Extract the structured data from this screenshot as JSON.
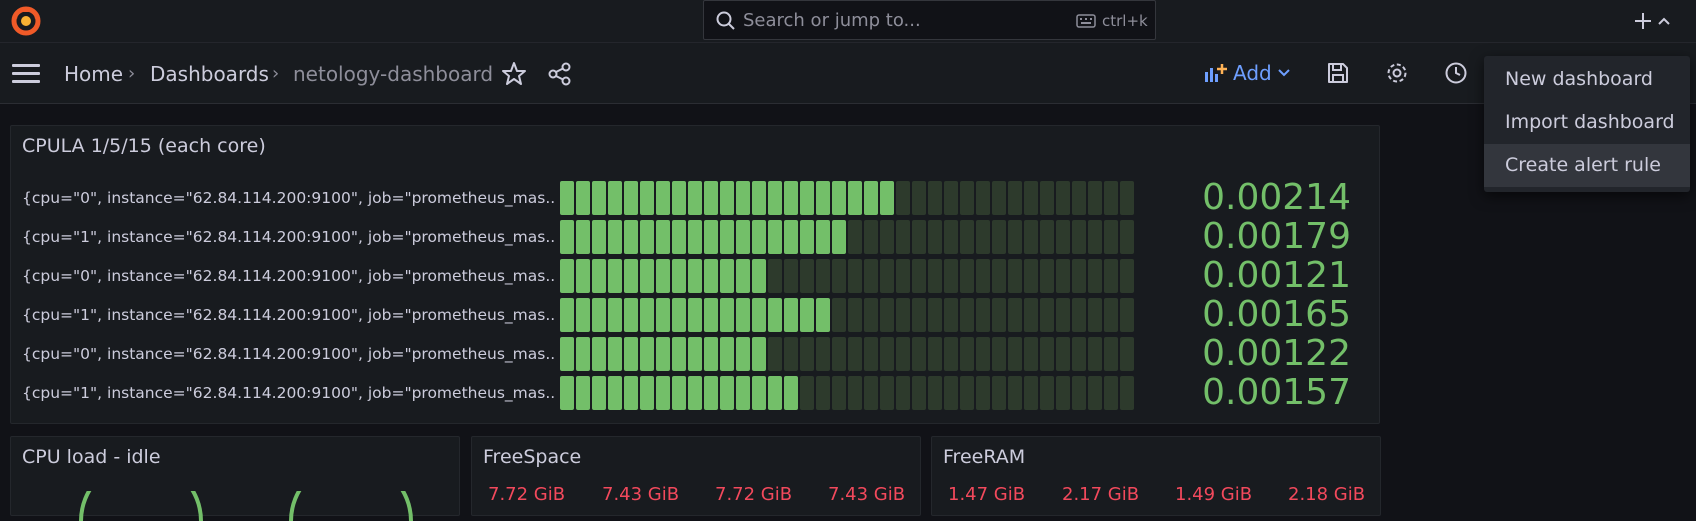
{
  "topbar": {
    "search_placeholder": "Search or jump to...",
    "shortcut": "ctrl+k",
    "plus_label": "+"
  },
  "breadcrumb": {
    "home": "Home",
    "dashboards": "Dashboards",
    "current": "netology-dashboard",
    "separator": "›"
  },
  "toolbar": {
    "add_label": "Add"
  },
  "add_menu": {
    "items": [
      "New dashboard",
      "Import dashboard",
      "Create alert rule"
    ],
    "active_index": 2
  },
  "panels": {
    "cpula": {
      "title": "CPULA 1/5/15 (each core)",
      "rows": [
        {
          "label": "{cpu=\"0\", instance=\"62.84.114.200:9100\", job=\"prometheus_mas...",
          "value": "0.00214",
          "fill": 0.59
        },
        {
          "label": "{cpu=\"1\", instance=\"62.84.114.200:9100\", job=\"prometheus_mas...",
          "value": "0.00179",
          "fill": 0.51
        },
        {
          "label": "{cpu=\"0\", instance=\"62.84.114.200:9100\", job=\"prometheus_mas...",
          "value": "0.00121",
          "fill": 0.35
        },
        {
          "label": "{cpu=\"1\", instance=\"62.84.114.200:9100\", job=\"prometheus_mas...",
          "value": "0.00165",
          "fill": 0.46
        },
        {
          "label": "{cpu=\"0\", instance=\"62.84.114.200:9100\", job=\"prometheus_mas...",
          "value": "0.00122",
          "fill": 0.35
        },
        {
          "label": "{cpu=\"1\", instance=\"62.84.114.200:9100\", job=\"prometheus_mas...",
          "value": "0.00157",
          "fill": 0.43
        }
      ]
    },
    "cpu_idle": {
      "title": "CPU load - idle"
    },
    "freespace": {
      "title": "FreeSpace",
      "values": [
        "7.72 GiB",
        "7.43 GiB",
        "7.72 GiB",
        "7.43 GiB"
      ]
    },
    "freeram": {
      "title": "FreeRAM",
      "values": [
        "1.47 GiB",
        "2.17 GiB",
        "1.49 GiB",
        "2.18 GiB"
      ]
    }
  },
  "colors": {
    "accent": "#6e9fff",
    "green": "#73bf69",
    "red": "#f2495c"
  }
}
